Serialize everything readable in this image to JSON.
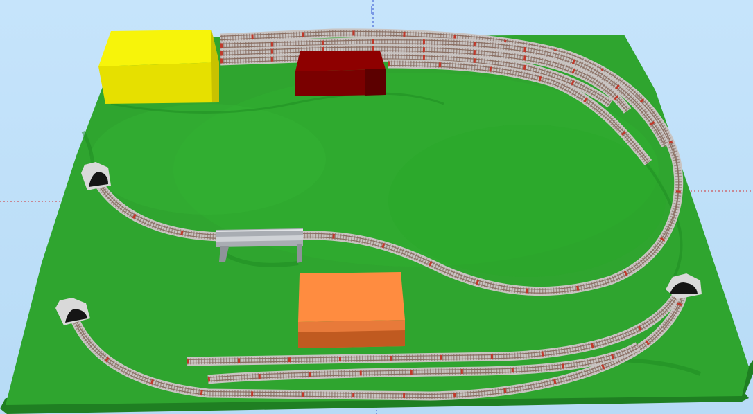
{
  "scene": {
    "kind": "3d-model-railway-layout",
    "sky_color": "#bfe0f8",
    "baseboard_color": "#2fa52f",
    "baseboard_shadow_color": "#1f7f22",
    "ballast_color": "#c9c4c2",
    "rail_color": "#8a6f62",
    "sleeper_color": "#c0392b",
    "bridge_color": "#a9adb3",
    "tunnel_portal_color": "#d9d9d9",
    "axes": {
      "red_axis": "#d23030",
      "green_axis": "#2fb52f",
      "blue_axis": "#3050d0"
    },
    "buildings": [
      {
        "id": "yellow",
        "color_front": "#e6e000",
        "color_top": "#f7f40a",
        "color_side": "#c8c200"
      },
      {
        "id": "dark-red",
        "color_front": "#7a0000",
        "color_top": "#8e0000",
        "color_side": "#5c0000"
      },
      {
        "id": "orange",
        "color_front": "#e87a3a",
        "color_top": "#ff8c40",
        "color_side": "#c05a20"
      }
    ],
    "tunnel_portals": [
      "upper-left",
      "lower-left",
      "lower-right"
    ]
  }
}
